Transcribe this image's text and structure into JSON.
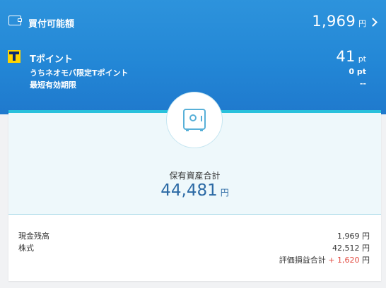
{
  "buying_power": {
    "label": "買付可能額",
    "value": "1,969",
    "unit": "円"
  },
  "tpoint": {
    "label": "Tポイント",
    "value": "41",
    "unit": "pt",
    "limited_label": "うちネオモバ限定Tポイント",
    "limited_value": "0 pt",
    "expiry_label": "最短有効期限",
    "expiry_value": "--"
  },
  "assets": {
    "total_label": "保有資産合計",
    "total_value": "44,481",
    "total_unit": "円",
    "rows": [
      {
        "label": "現金残高",
        "value": "1,969 円"
      },
      {
        "label": "株式",
        "value": "42,512 円"
      }
    ],
    "pl_label": "評価損益合計",
    "pl_sign": "+",
    "pl_value": "1,620",
    "pl_unit": "円"
  },
  "icons": [
    "wallet-icon",
    "tpoint-logo-icon",
    "chevron-right-icon",
    "safe-icon"
  ],
  "colors": {
    "header": "#2387d6",
    "accent_line": "#29c1dc",
    "total_text": "#2c6aa5",
    "gain": "#e24a40"
  }
}
